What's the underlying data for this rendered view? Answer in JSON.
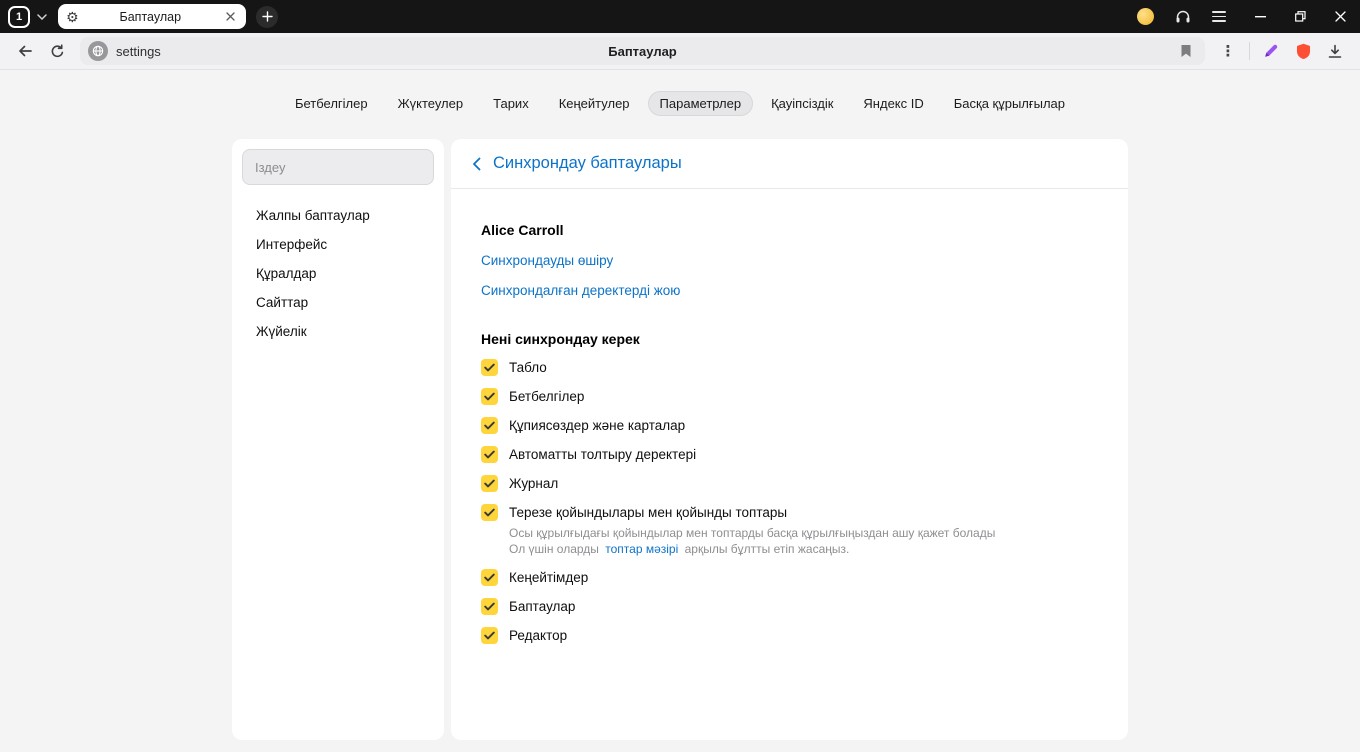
{
  "window": {
    "tab_counter": "1",
    "tab_title": "Баптаулар"
  },
  "toolbar": {
    "url": "settings",
    "page_title": "Баптаулар"
  },
  "icons": {
    "settings_gear": "⚙",
    "overflow_kebab": "⋮"
  },
  "nav": {
    "active": "Параметрлер",
    "items": [
      {
        "label": "Бетбелгілер"
      },
      {
        "label": "Жүктеулер"
      },
      {
        "label": "Тарих"
      },
      {
        "label": "Кеңейтулер"
      },
      {
        "label": "Параметрлер"
      },
      {
        "label": "Қауіпсіздік"
      },
      {
        "label": "Яндекс ID"
      },
      {
        "label": "Басқа құрылғылар"
      }
    ]
  },
  "sidebar": {
    "search_placeholder": "Іздеу",
    "items": [
      {
        "label": "Жалпы баптаулар"
      },
      {
        "label": "Интерфейс"
      },
      {
        "label": "Құралдар"
      },
      {
        "label": "Сайттар"
      },
      {
        "label": "Жүйелік"
      }
    ]
  },
  "main": {
    "title": "Синхрондау баптаулары",
    "account_name": "Alice Carroll",
    "link_disable_sync": "Синхрондауды өшіру",
    "link_delete_data": "Синхрондалған деректерді жою",
    "section_title": "Нені синхрондау керек",
    "checkboxes": [
      {
        "label": "Табло",
        "checked": true
      },
      {
        "label": "Бетбелгілер",
        "checked": true
      },
      {
        "label": "Құпиясөздер және карталар",
        "checked": true
      },
      {
        "label": "Автоматты толтыру деректері",
        "checked": true
      },
      {
        "label": "Журнал",
        "checked": true
      },
      {
        "label": "Терезе қойындылары мен қойынды топтары",
        "checked": true
      },
      {
        "label": "Кеңейтімдер",
        "checked": true
      },
      {
        "label": "Баптаулар",
        "checked": true
      },
      {
        "label": "Редактор",
        "checked": true
      }
    ],
    "note": {
      "line1": "Осы құрылғыдағы қойындылар мен топтарды басқа құрылғыңыздан ашу қажет болады",
      "line2_before": "Ол үшін оларды",
      "line2_link": "топтар мәзірі",
      "line2_after": "арқылы бұлтты етіп жасаңыз."
    }
  },
  "colors": {
    "accent_blue": "#0c73c8",
    "checkbox_yellow": "#ffd53c",
    "protect_red": "#fc4f34",
    "pen_purple": "#9a55f0",
    "avatar_yellow": "#f0b429",
    "titlebar_black": "#151515"
  }
}
